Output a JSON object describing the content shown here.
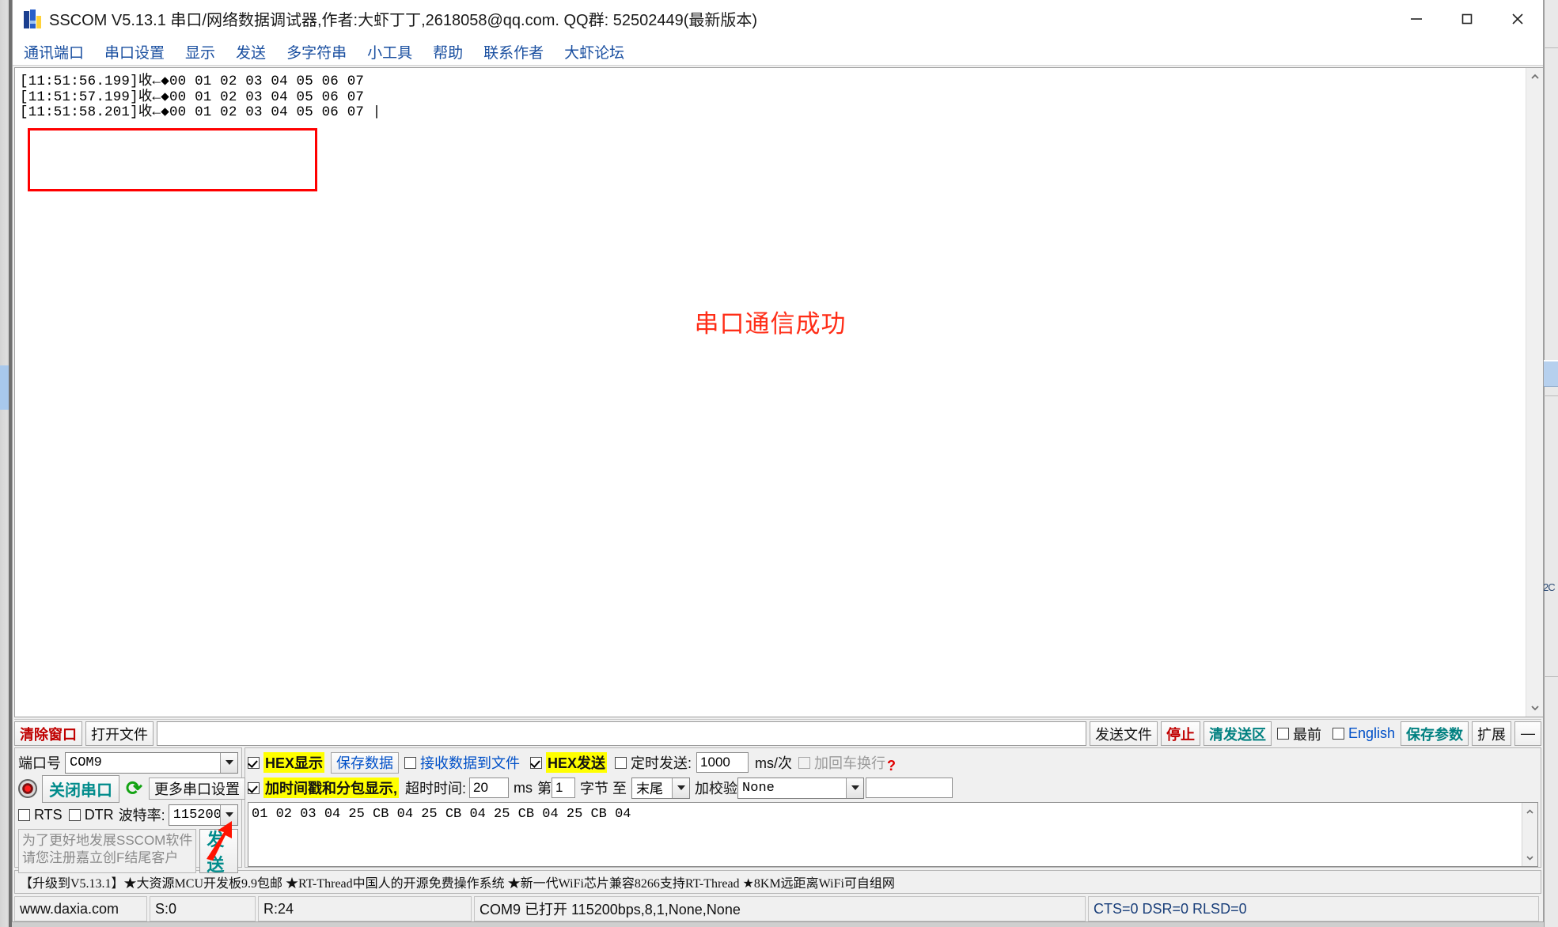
{
  "window": {
    "title": "SSCOM V5.13.1 串口/网络数据调试器,作者:大虾丁丁,2618058@qq.com. QQ群: 52502449(最新版本)",
    "minimize": "–",
    "maximize": "□",
    "close": "✕"
  },
  "menubar": {
    "items": [
      {
        "label": "通讯端口"
      },
      {
        "label": "串口设置"
      },
      {
        "label": "显示"
      },
      {
        "label": "发送"
      },
      {
        "label": "多字符串"
      },
      {
        "label": "小工具"
      },
      {
        "label": "帮助"
      },
      {
        "label": "联系作者"
      },
      {
        "label": "大虾论坛"
      }
    ]
  },
  "receive": {
    "lines": [
      "[11:51:56.199]收←◆00 01 02 03 04 05 06 07",
      "[11:51:57.199]收←◆00 01 02 03 04 05 06 07",
      "[11:51:58.201]收←◆00 01 02 03 04 05 06 07 |"
    ],
    "annotation_text": "串口通信成功",
    "annotation_color": "#ff2d17",
    "highlight_box_color": "#ff0000"
  },
  "toolbar": {
    "clear_window": "清除窗口",
    "open_file": "打开文件",
    "file_path_value": "",
    "send_file": "发送文件",
    "stop": "停止",
    "clear_send_area": "清发送区",
    "topmost_label": "最前",
    "topmost_checked": false,
    "english_label": "English",
    "english_checked": false,
    "save_params": "保存参数",
    "extend": "扩展",
    "collapse": "—"
  },
  "port_config": {
    "port_label": "端口号",
    "port_value": "COM9",
    "close_port_button": "关闭串口",
    "more_settings_button": "更多串口设置",
    "rts_label": "RTS",
    "rts_checked": false,
    "dtr_label": "DTR",
    "dtr_checked": false,
    "baud_label": "波特率:",
    "baud_value": "115200",
    "notice_line1": "为了更好地发展SSCOM软件",
    "notice_line2": "请您注册嘉立创F结尾客户",
    "send_button": "发 送"
  },
  "display_config": {
    "hex_display_label": "HEX显示",
    "hex_display_checked": true,
    "save_data_button": "保存数据",
    "recv_to_file_label": "接收数据到文件",
    "recv_to_file_checked": false,
    "hex_send_label": "HEX发送",
    "hex_send_checked": true,
    "timed_send_label": "定时发送:",
    "timed_send_checked": false,
    "timed_send_value": "1000",
    "timed_send_unit": "ms/次",
    "add_crlf_label": "加回车换行",
    "add_crlf_checked": false,
    "help_marker": "?",
    "timestamp_label": "加时间戳和分包显示,",
    "timestamp_checked": true,
    "timeout_label": "超时时间:",
    "timeout_value": "20",
    "timeout_unit": "ms",
    "byte_prefix": "第",
    "byte_index_value": "1",
    "byte_mid": "字节 至",
    "byte_end_value": "末尾",
    "checksum_label": "加校验",
    "checksum_value": "None",
    "extra_value": ""
  },
  "send_area": {
    "text": "01 02 03 04 25 CB 04 25 CB 04 25 CB 04 25 CB 04"
  },
  "ad_bar": {
    "text": "【升级到V5.13.1】★大资源MCU开发板9.9包邮 ★RT-Thread中国人的开源免费操作系统 ★新一代WiFi芯片兼容8266支持RT-Thread ★8KM远距离WiFi可自组网"
  },
  "status_bar": {
    "website": "www.daxia.com",
    "sent": "S:0",
    "received": "R:24",
    "connection": "COM9 已打开  115200bps,8,1,None,None",
    "signals": "CTS=0 DSR=0 RLSD=0"
  },
  "background": {
    "right_text": "2C"
  }
}
